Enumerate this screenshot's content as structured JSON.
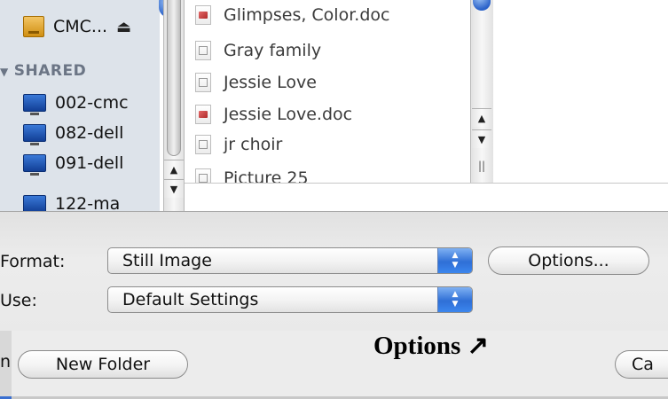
{
  "sidebar": {
    "devices": [
      {
        "label": "CMC...",
        "icon": "disk-icon"
      }
    ],
    "shared_header": "SHARED",
    "shared": [
      {
        "label": "002-cmc",
        "icon": "monitor-icon"
      },
      {
        "label": "082-dell",
        "icon": "monitor-icon"
      },
      {
        "label": "091-dell",
        "icon": "monitor-icon"
      },
      {
        "label": "122-ma",
        "icon": "monitor-icon"
      }
    ]
  },
  "files": [
    {
      "name": "Glimpses, Color.doc",
      "icon": "word-doc-icon"
    },
    {
      "name": "Gray family",
      "icon": "image-doc-icon"
    },
    {
      "name": "Jessie Love",
      "icon": "image-doc-icon"
    },
    {
      "name": "Jessie Love.doc",
      "icon": "word-doc-icon"
    },
    {
      "name": "jr choir",
      "icon": "image-doc-icon"
    },
    {
      "name": "Picture 25",
      "icon": "image-doc-icon"
    }
  ],
  "options": {
    "format_label": "Format:",
    "format_value": "Still Image",
    "use_label": "Use:",
    "use_value": "Default Settings",
    "options_button": "Options..."
  },
  "bottom": {
    "cut_label": "n",
    "new_folder_button": "New Folder",
    "cancel_button": "Ca",
    "annotation": "Options ↗"
  },
  "colors": {
    "popup_accent": "#2f6fd6",
    "sidebar_bg": "#dde3ea",
    "header_gray": "#6b7585"
  }
}
